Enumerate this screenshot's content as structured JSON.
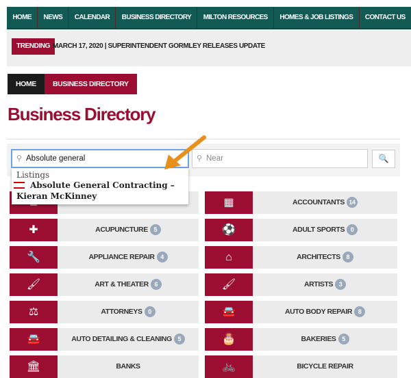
{
  "nav": [
    "HOME",
    "NEWS",
    "CALENDAR",
    "BUSINESS DIRECTORY",
    "MILTON RESOURCES",
    "HOMES & JOB LISTINGS",
    "CONTACT US"
  ],
  "trending": {
    "label": "TRENDING",
    "text": "MARCH 17, 2020  |  SUPERINTENDENT GORMLEY RELEASES UPDATE"
  },
  "breadcrumb": [
    "HOME",
    "BUSINESS DIRECTORY"
  ],
  "title": "Business Directory",
  "search": {
    "value": "Absolute general",
    "near_placeholder": "Near"
  },
  "dropdown": {
    "heading": "Listings",
    "result": "Absolute General Contracting – Kieran McKinney"
  },
  "colors": {
    "brand": "#9b0e32",
    "nav": "#135a55",
    "badge": "#99a8bb"
  },
  "categories": [
    {
      "label": "",
      "count": "",
      "icon": "building-icon"
    },
    {
      "label": "ACCOUNTANTS",
      "count": "14",
      "icon": "calculator-icon"
    },
    {
      "label": "ACUPUNCTURE",
      "count": "5",
      "icon": "medical-plus-icon"
    },
    {
      "label": "ADULT SPORTS",
      "count": "0",
      "icon": "soccer-ball-icon"
    },
    {
      "label": "APPLIANCE REPAIR",
      "count": "4",
      "icon": "wrench-icon"
    },
    {
      "label": "ARCHITECTS",
      "count": "8",
      "icon": "home-icon"
    },
    {
      "label": "ART & THEATER",
      "count": "6",
      "icon": "paintbrush-icon"
    },
    {
      "label": "ARTISTS",
      "count": "3",
      "icon": "paintbrush-icon"
    },
    {
      "label": "ATTORNEYS",
      "count": "0",
      "icon": "scales-icon"
    },
    {
      "label": "AUTO BODY REPAIR",
      "count": "8",
      "icon": "car-icon"
    },
    {
      "label": "AUTO DETAILING & CLEANING",
      "count": "5",
      "icon": "car-icon"
    },
    {
      "label": "BAKERIES",
      "count": "5",
      "icon": "cake-icon"
    },
    {
      "label": "BANKS",
      "count": "",
      "icon": "bank-icon"
    },
    {
      "label": "BICYCLE REPAIR",
      "count": "",
      "icon": "bicycle-icon"
    }
  ]
}
